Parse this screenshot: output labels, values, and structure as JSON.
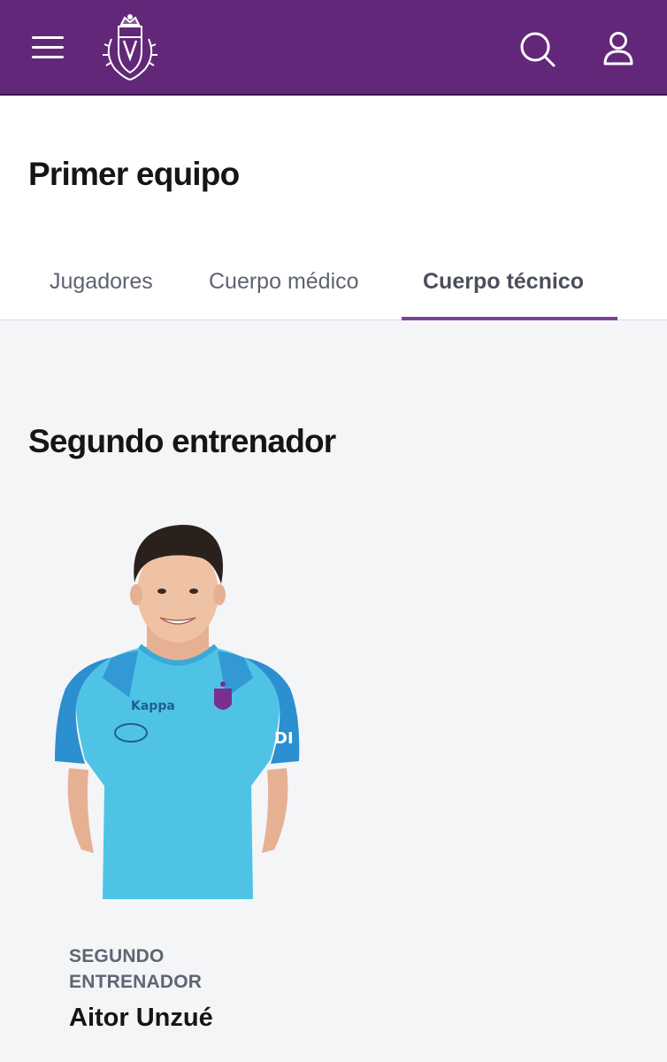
{
  "header": {
    "menu_icon": "hamburger-menu-icon",
    "logo_icon": "club-crest-icon",
    "search_icon": "search-icon",
    "user_icon": "user-icon",
    "bar_color": "#632779"
  },
  "page": {
    "title": "Primer equipo"
  },
  "tabs": [
    {
      "label": "Jugadores",
      "active": false
    },
    {
      "label": "Cuerpo médico",
      "active": false
    },
    {
      "label": "Cuerpo técnico",
      "active": true
    }
  ],
  "section": {
    "title": "Segundo entrenador",
    "members": [
      {
        "role": "SEGUNDO ENTRENADOR",
        "name": "Aitor Unzué",
        "shirt_color": "#4fc3e6"
      }
    ]
  }
}
